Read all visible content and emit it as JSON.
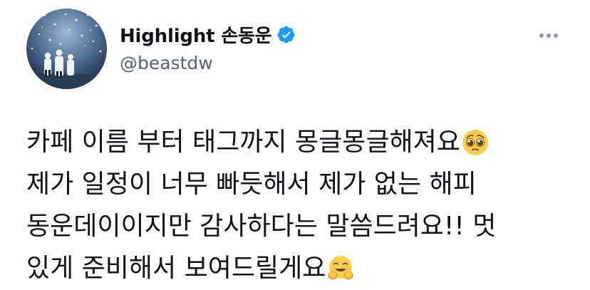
{
  "author": {
    "display_name": "Highlight 손동운",
    "handle": "@beastdw",
    "avatar_icon": "concert-stage-photo",
    "verified_icon": "verified-badge-icon",
    "verified_color": "#1d9bf0"
  },
  "menu": {
    "more_icon": "more-horizontal-icon"
  },
  "tweet": {
    "lines": [
      {
        "text": "카페 이름 부터 태그까지 몽글몽글해져요",
        "emoji": "pleading-face"
      },
      {
        "text": "제가 일정이 너무 빠듯해서 제가 없는 해피"
      },
      {
        "text": "동운데이이지만 감사하다는 말씀드려요!! 멋"
      },
      {
        "text": "있게 준비해서 보여드릴게요",
        "emoji": "hugging-face"
      }
    ]
  },
  "colors": {
    "text": "#0f1419",
    "secondary": "#536471",
    "background": "#ffffff"
  }
}
